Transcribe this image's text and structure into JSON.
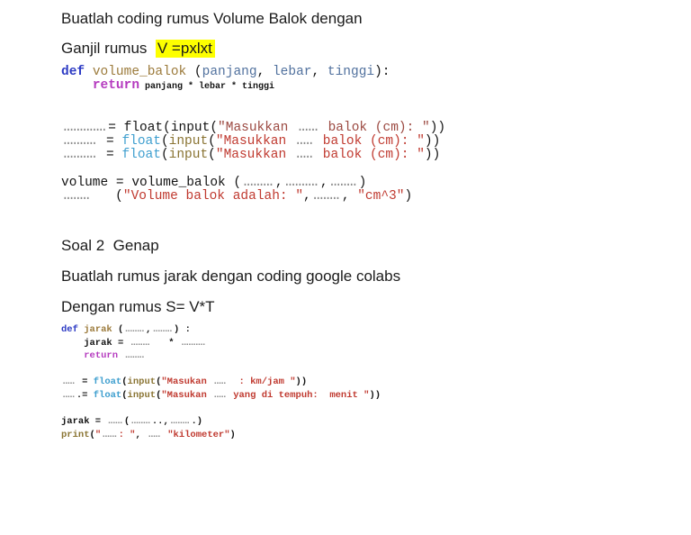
{
  "colors": {
    "hl": "#fdff00",
    "k": "#2d3bc4",
    "fn": "#9c7b3c",
    "pa": "#51719e",
    "rt": "#b53bbf",
    "bi": "#3f9fcf",
    "fi": "#8a7433",
    "s": "#c03a30",
    "sd": "#9c4a42",
    "d": "#8c8c8c"
  },
  "headings": {
    "title_line1": "Buatlah coding rumus Volume Balok dengan",
    "title_line2_prefix": "Ganjil rumus  ",
    "title_line2_highlight": "V =pxlxt",
    "soal2": "Soal 2  Genap",
    "soal2_line2": "Buatlah rumus jarak dengan coding google colabs",
    "soal2_line3": "Dengan rumus S= V*T"
  },
  "code_block_1": {
    "lines": [
      [
        {
          "t": "def",
          "c": "k"
        },
        {
          "t": " ",
          "c": "p"
        },
        {
          "t": "volume_balok",
          "c": "fn"
        },
        {
          "t": " (",
          "c": "p"
        },
        {
          "t": "panjang",
          "c": "pa"
        },
        {
          "t": ", ",
          "c": "p"
        },
        {
          "t": "lebar",
          "c": "pa"
        },
        {
          "t": ", ",
          "c": "p"
        },
        {
          "t": "tinggi",
          "c": "pa"
        },
        {
          "t": "):",
          "c": "p"
        }
      ],
      [
        {
          "t": "    ",
          "c": "p"
        },
        {
          "t": "return",
          "c": "rt"
        },
        {
          "t": " panjang * lebar * tinggi",
          "c": "sm"
        }
      ],
      [],
      [],
      [
        {
          "t": ".............",
          "c": "d"
        },
        {
          "t": "= float(input(",
          "c": "p"
        },
        {
          "t": "\"Masukkan ",
          "c": "sd"
        },
        {
          "t": "......",
          "c": "d"
        },
        {
          "t": " balok (cm): \"",
          "c": "sd"
        },
        {
          "t": "))",
          "c": "p"
        }
      ],
      [
        {
          "t": "..........",
          "c": "d"
        },
        {
          "t": " = ",
          "c": "p"
        },
        {
          "t": "float",
          "c": "bi"
        },
        {
          "t": "(",
          "c": "p"
        },
        {
          "t": "input",
          "c": "fi"
        },
        {
          "t": "(",
          "c": "p"
        },
        {
          "t": "\"Masukkan ",
          "c": "s"
        },
        {
          "t": ".....",
          "c": "d"
        },
        {
          "t": " balok (cm): \"",
          "c": "s"
        },
        {
          "t": "))",
          "c": "p"
        }
      ],
      [
        {
          "t": "..........",
          "c": "d"
        },
        {
          "t": " = ",
          "c": "p"
        },
        {
          "t": "float",
          "c": "bi"
        },
        {
          "t": "(",
          "c": "p"
        },
        {
          "t": "input",
          "c": "fi"
        },
        {
          "t": "(",
          "c": "p"
        },
        {
          "t": "\"Masukkan ",
          "c": "s"
        },
        {
          "t": ".....",
          "c": "d"
        },
        {
          "t": " balok (cm): \"",
          "c": "s"
        },
        {
          "t": "))",
          "c": "p"
        }
      ],
      [],
      [
        {
          "t": "volume = volume_balok (",
          "c": "p"
        },
        {
          "t": ".........",
          "c": "d"
        },
        {
          "t": ",",
          "c": "p"
        },
        {
          "t": "..........",
          "c": "d"
        },
        {
          "t": ",",
          "c": "p"
        },
        {
          "t": "........",
          "c": "d"
        },
        {
          "t": ")",
          "c": "p"
        }
      ],
      [
        {
          "t": "........",
          "c": "d"
        },
        {
          "t": "   (",
          "c": "p"
        },
        {
          "t": "\"Volume balok adalah: \"",
          "c": "s"
        },
        {
          "t": ",",
          "c": "p"
        },
        {
          "t": "........",
          "c": "d"
        },
        {
          "t": ", ",
          "c": "p"
        },
        {
          "t": "\"cm^3\"",
          "c": "s"
        },
        {
          "t": ")",
          "c": "p"
        }
      ]
    ]
  },
  "code_block_2": {
    "lines": [
      [
        {
          "t": "def",
          "c": "k"
        },
        {
          "t": " ",
          "c": "p"
        },
        {
          "t": "jarak",
          "c": "fn"
        },
        {
          "t": " (",
          "c": "p"
        },
        {
          "t": "........",
          "c": "d"
        },
        {
          "t": ",",
          "c": "p"
        },
        {
          "t": "........",
          "c": "d"
        },
        {
          "t": ") :",
          "c": "p"
        }
      ],
      [
        {
          "t": "    jarak = ",
          "c": "p"
        },
        {
          "t": "........",
          "c": "d"
        },
        {
          "t": "   * ",
          "c": "p"
        },
        {
          "t": "..........",
          "c": "d"
        }
      ],
      [
        {
          "t": "    ",
          "c": "p"
        },
        {
          "t": "return",
          "c": "rt"
        },
        {
          "t": " ",
          "c": "p"
        },
        {
          "t": "........",
          "c": "d"
        }
      ],
      [],
      [
        {
          "t": ".....",
          "c": "d"
        },
        {
          "t": " = ",
          "c": "p"
        },
        {
          "t": "float",
          "c": "bi"
        },
        {
          "t": "(",
          "c": "p"
        },
        {
          "t": "input",
          "c": "fi"
        },
        {
          "t": "(",
          "c": "p"
        },
        {
          "t": "\"Masukan ",
          "c": "s"
        },
        {
          "t": ".....",
          "c": "d"
        },
        {
          "t": "  : km/jam \"",
          "c": "s"
        },
        {
          "t": "))",
          "c": "p"
        }
      ],
      [
        {
          "t": ".....",
          "c": "d"
        },
        {
          "t": ".= ",
          "c": "p"
        },
        {
          "t": "float",
          "c": "bi"
        },
        {
          "t": "(",
          "c": "p"
        },
        {
          "t": "input",
          "c": "fi"
        },
        {
          "t": "(",
          "c": "p"
        },
        {
          "t": "\"Masukan ",
          "c": "s"
        },
        {
          "t": ".....",
          "c": "d"
        },
        {
          "t": " yang di tempuh:  menit \"",
          "c": "s"
        },
        {
          "t": "))",
          "c": "p"
        }
      ],
      [],
      [
        {
          "t": "jarak = ",
          "c": "p"
        },
        {
          "t": "......",
          "c": "d"
        },
        {
          "t": "(",
          "c": "p"
        },
        {
          "t": "........",
          "c": "d"
        },
        {
          "t": "..,",
          "c": "p"
        },
        {
          "t": "........",
          "c": "d"
        },
        {
          "t": ".)",
          "c": "p"
        }
      ],
      [
        {
          "t": "print",
          "c": "fi"
        },
        {
          "t": "(",
          "c": "p"
        },
        {
          "t": "\"",
          "c": "s"
        },
        {
          "t": "......",
          "c": "d"
        },
        {
          "t": ": \"",
          "c": "s"
        },
        {
          "t": ", ",
          "c": "p"
        },
        {
          "t": ".....",
          "c": "d"
        },
        {
          "t": " ",
          "c": "p"
        },
        {
          "t": "\"kilometer\"",
          "c": "s"
        },
        {
          "t": ")",
          "c": "p"
        }
      ]
    ]
  }
}
